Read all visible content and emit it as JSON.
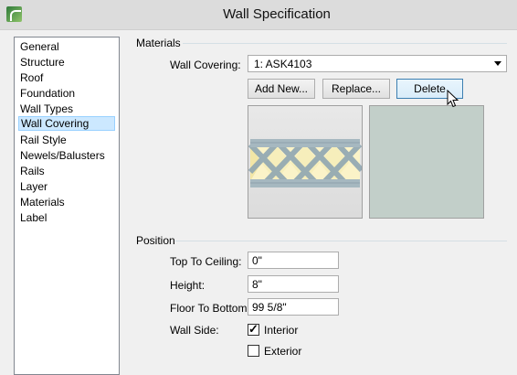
{
  "window": {
    "title": "Wall Specification"
  },
  "nav": {
    "items": [
      "General",
      "Structure",
      "Roof",
      "Foundation",
      "Wall Types",
      "Wall Covering",
      "Rail Style",
      "Newels/Balusters",
      "Rails",
      "Layer",
      "Materials",
      "Label"
    ],
    "selected": "Wall Covering"
  },
  "materials": {
    "group_label": "Materials",
    "wall_covering_label": "Wall Covering:",
    "wall_covering_value": "1:  ASK4103",
    "buttons": {
      "add_new": "Add New...",
      "replace": "Replace...",
      "delete": "Delete"
    },
    "preview_color": "#c2cfc9"
  },
  "position": {
    "group_label": "Position",
    "top_to_ceiling_label": "Top To Ceiling:",
    "top_to_ceiling_value": "0\"",
    "height_label": "Height:",
    "height_value": "8\"",
    "floor_to_bottom_label": "Floor To Bottom:",
    "floor_to_bottom_value": "99 5/8\"",
    "wall_side_label": "Wall Side:",
    "interior_label": "Interior",
    "interior_checked": true,
    "exterior_label": "Exterior",
    "exterior_checked": false
  }
}
